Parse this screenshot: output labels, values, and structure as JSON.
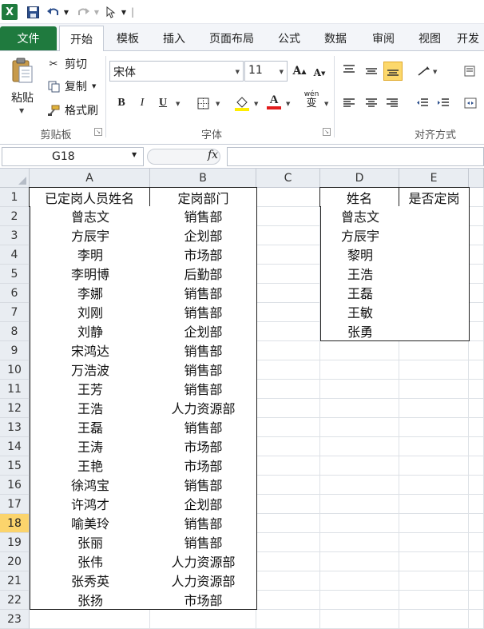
{
  "quick_access": {
    "logo": "X",
    "separator": "|"
  },
  "tabs": [
    "文件",
    "开始",
    "模板",
    "插入",
    "页面布局",
    "公式",
    "数据",
    "审阅",
    "视图",
    "开发"
  ],
  "ribbon": {
    "paste_label": "粘贴",
    "cut_label": "剪切",
    "copy_label": "复制",
    "format_painter_label": "格式刷",
    "clipboard_group": "剪贴板",
    "font_group": "字体",
    "align_group": "对齐方式",
    "font_name": "宋体",
    "font_size": "11",
    "bold": "B",
    "italic": "I",
    "underline": "U",
    "grow_font": "A",
    "shrink_font": "A",
    "font_color_glyph": "A",
    "phonetic": "wén",
    "phonetic_char": "变"
  },
  "formula_bar": {
    "name_box": "G18",
    "fx": "fx",
    "formula": ""
  },
  "columns": [
    "A",
    "B",
    "C",
    "D",
    "E"
  ],
  "rows": [
    "1",
    "2",
    "3",
    "4",
    "5",
    "6",
    "7",
    "8",
    "9",
    "10",
    "11",
    "12",
    "13",
    "14",
    "15",
    "16",
    "17",
    "18",
    "19",
    "20",
    "21",
    "22",
    "23"
  ],
  "selected_row": "18",
  "table_left": {
    "headers": [
      "已定岗人员姓名",
      "定岗部门"
    ],
    "rows": [
      [
        "曾志文",
        "销售部"
      ],
      [
        "方辰宇",
        "企划部"
      ],
      [
        "李明",
        "市场部"
      ],
      [
        "李明博",
        "后勤部"
      ],
      [
        "李娜",
        "销售部"
      ],
      [
        "刘刚",
        "销售部"
      ],
      [
        "刘静",
        "企划部"
      ],
      [
        "宋鸿达",
        "销售部"
      ],
      [
        "万浩波",
        "销售部"
      ],
      [
        "王芳",
        "销售部"
      ],
      [
        "王浩",
        "人力资源部"
      ],
      [
        "王磊",
        "销售部"
      ],
      [
        "王涛",
        "市场部"
      ],
      [
        "王艳",
        "市场部"
      ],
      [
        "徐鸿宝",
        "销售部"
      ],
      [
        "许鸿才",
        "企划部"
      ],
      [
        "喻美玲",
        "销售部"
      ],
      [
        "张丽",
        "销售部"
      ],
      [
        "张伟",
        "人力资源部"
      ],
      [
        "张秀英",
        "人力资源部"
      ],
      [
        "张扬",
        "市场部"
      ]
    ]
  },
  "table_right": {
    "headers": [
      "姓名",
      "是否定岗"
    ],
    "rows": [
      [
        "曾志文",
        ""
      ],
      [
        "方辰宇",
        ""
      ],
      [
        "黎明",
        ""
      ],
      [
        "王浩",
        ""
      ],
      [
        "王磊",
        ""
      ],
      [
        "王敏",
        ""
      ],
      [
        "张勇",
        ""
      ]
    ]
  }
}
